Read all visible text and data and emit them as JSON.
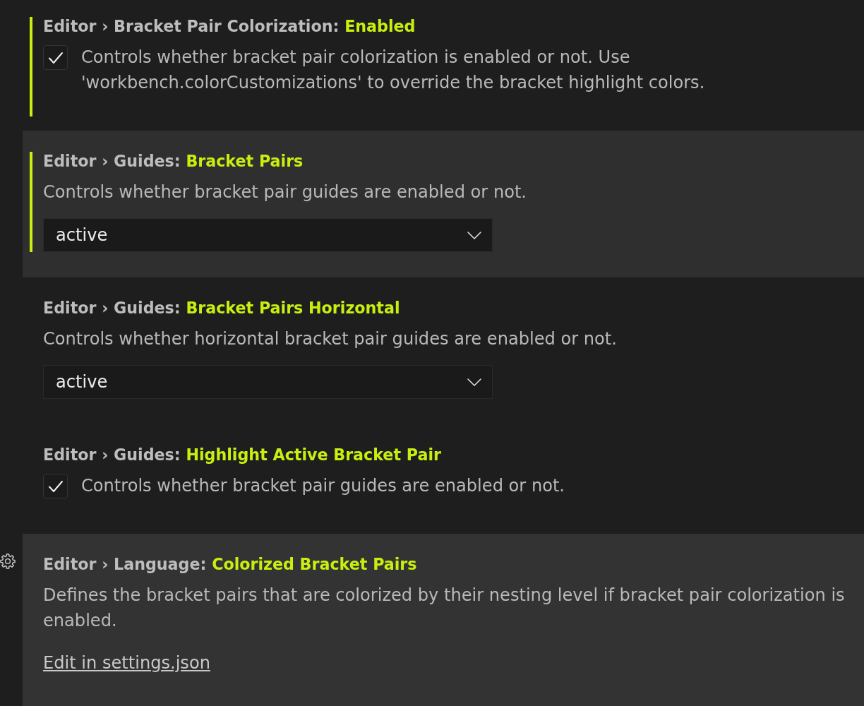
{
  "settings": [
    {
      "category": "Editor › Bracket Pair Colorization:",
      "name": "Enabled",
      "kind": "checkbox",
      "checked": true,
      "description": "Controls whether bracket pair colorization is enabled or not. Use 'workbench.colorCustomizations' to override the bracket highlight colors.",
      "modified": true,
      "focused": false,
      "hovered": false
    },
    {
      "category": "Editor › Guides:",
      "name": "Bracket Pairs",
      "kind": "select",
      "value": "active",
      "description": "Controls whether bracket pair guides are enabled or not.",
      "modified": true,
      "focused": true,
      "hovered": false
    },
    {
      "category": "Editor › Guides:",
      "name": "Bracket Pairs Horizontal",
      "kind": "select",
      "value": "active",
      "description": "Controls whether horizontal bracket pair guides are enabled or not.",
      "modified": false,
      "focused": false,
      "hovered": false
    },
    {
      "category": "Editor › Guides:",
      "name": "Highlight Active Bracket Pair",
      "kind": "checkbox",
      "checked": true,
      "description": "Controls whether bracket pair guides are enabled or not.",
      "modified": false,
      "focused": false,
      "hovered": false
    },
    {
      "category": "Editor › Language:",
      "name": "Colorized Bracket Pairs",
      "kind": "link",
      "link": "Edit in settings.json",
      "description": "Defines the bracket pairs that are colorized by their nesting level if bracket pair colorization is enabled.",
      "modified": false,
      "focused": false,
      "hovered": true
    }
  ]
}
